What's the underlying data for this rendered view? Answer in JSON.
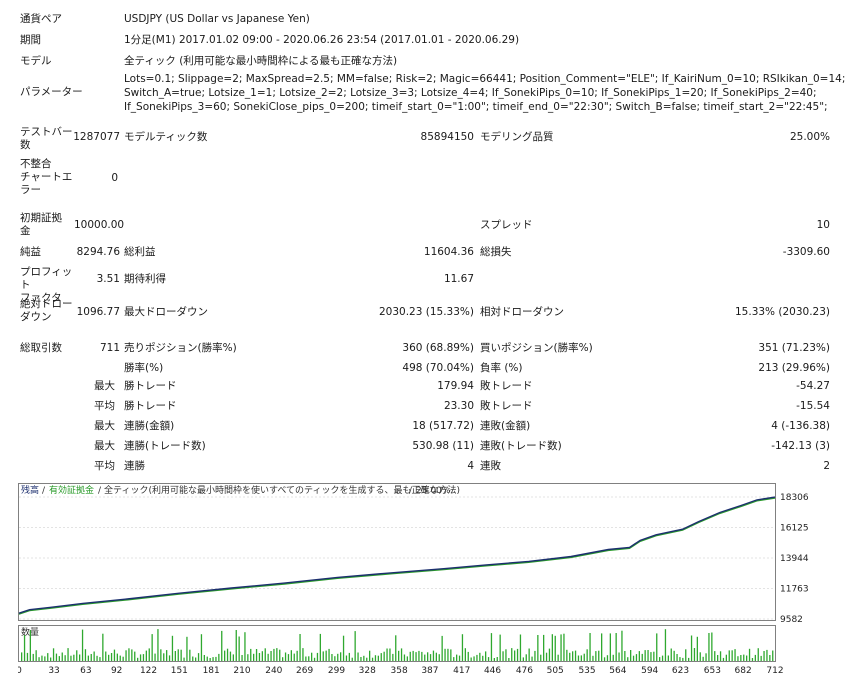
{
  "header": {
    "symbol_label": "通貨ペア",
    "symbol_value": "USDJPY (US Dollar vs Japanese Yen)",
    "period_label": "期間",
    "period_value": "1分足(M1) 2017.01.02 09:00 - 2020.06.26 23:54 (2017.01.01 - 2020.06.29)",
    "model_label": "モデル",
    "model_value": "全ティック (利用可能な最小時間枠による最も正確な方法)",
    "params_label": "パラメーター",
    "params_line1": "Lots=0.1; Slippage=2; MaxSpread=2.5; MM=false; Risk=2; Magic=66441; Position_Comment=\"ELE\"; If_KairiNum_0=10; RSIkikan_0=14;",
    "params_line2": "Switch_A=true; Lotsize_1=1; Lotsize_2=2; Lotsize_3=3; Lotsize_4=4; If_SonekiPips_0=10; If_SonekiPips_1=20; If_SonekiPips_2=40;",
    "params_line3": "If_SonekiPips_3=60; SonekiClose_pips_0=200; timeif_start_0=\"1:00\"; timeif_end_0=\"22:30\"; Switch_B=false; timeif_start_2=\"22:45\";"
  },
  "stats": {
    "bars_label_1": "テストバー",
    "bars_label_2": "数",
    "bars_value": "1287077",
    "ticks_label": "モデルティック数",
    "ticks_value": "85894150",
    "quality_label": "モデリング品質",
    "quality_value": "25.00%",
    "mismatch_label_1": "不整合",
    "mismatch_label_2": "チャートエ",
    "mismatch_label_3": "ラー",
    "mismatch_value": "0",
    "deposit_label_1": "初期証拠",
    "deposit_label_2": "金",
    "deposit_value": "10000.00",
    "spread_label": "スプレッド",
    "spread_value": "10",
    "net_label": "純益",
    "net_value": "8294.76",
    "gross_profit_label": "総利益",
    "gross_profit_value": "11604.36",
    "gross_loss_label": "総損失",
    "gross_loss_value": "-3309.60",
    "pf_label_1": "プロフィット",
    "pf_label_2": "ファクタ",
    "pf_value": "3.51",
    "expected_label": "期待利得",
    "expected_value": "11.67",
    "abs_dd_label_1": "絶対ドロー",
    "abs_dd_label_2": "ダウン",
    "abs_dd_value": "1096.77",
    "max_dd_label": "最大ドローダウン",
    "max_dd_value": "2030.23 (15.33%)",
    "rel_dd_label": "相対ドローダウン",
    "rel_dd_value": "15.33% (2030.23)",
    "total_label": "総取引数",
    "total_value": "711",
    "short_label": "売りポジション(勝率%)",
    "short_value": "360 (68.89%)",
    "long_label": "買いポジション(勝率%)",
    "long_value": "351 (71.23%)",
    "winrate_label": "勝率(%)",
    "winrate_value": "498 (70.04%)",
    "lossrate_label": "負率 (%)",
    "lossrate_value": "213 (29.96%)",
    "max_label": "最大",
    "avg_label": "平均",
    "max_win_label": "勝トレード",
    "max_win_value": "179.94",
    "max_loss_label": "敗トレード",
    "max_loss_value": "-54.27",
    "avg_win_label": "勝トレード",
    "avg_win_value": "23.30",
    "avg_loss_label": "敗トレード",
    "avg_loss_value": "-15.54",
    "consec_win_amt_label": "連勝(金額)",
    "consec_win_amt_value": "18 (517.72)",
    "consec_loss_amt_label": "連敗(金額)",
    "consec_loss_amt_value": "4 (-136.38)",
    "consec_win_profit_label": "連勝(トレード数)",
    "consec_win_profit_value": "530.98 (11)",
    "consec_loss_profit_label": "連敗(トレード数)",
    "consec_loss_profit_value": "-142.13 (3)",
    "avg_consec_win_label": "連勝",
    "avg_consec_win_value": "4",
    "avg_consec_loss_label": "連敗",
    "avg_consec_loss_value": "2"
  },
  "chart": {
    "legend_balance": "残高",
    "legend_sep1": "/",
    "legend_equity": "有効証拠金",
    "legend_sep2": "/",
    "legend_model": "全ティック(利用可能な最小時間枠を使いすべてのティックを生成する、最も正確な方法)",
    "legend_sep3": "/",
    "legend_quality": "25.00%",
    "volume_label": "数量",
    "colors": {
      "balance": "#1c2f6e",
      "equity": "#2a9b2a",
      "volume": "#2fa82f",
      "grid": "#c8c8c8"
    }
  },
  "chart_data": {
    "type": "line",
    "y_ticks": [
      "18306",
      "16125",
      "13944",
      "11763",
      "9582"
    ],
    "ylim": [
      9582,
      18306
    ],
    "x_ticks": [
      "0",
      "33",
      "63",
      "92",
      "122",
      "151",
      "181",
      "210",
      "240",
      "269",
      "299",
      "328",
      "358",
      "387",
      "417",
      "446",
      "476",
      "505",
      "535",
      "564",
      "594",
      "623",
      "653",
      "682",
      "712"
    ],
    "xlim": [
      0,
      712
    ],
    "series": [
      {
        "name": "残高",
        "x": [
          0,
          10,
          30,
          60,
          100,
          150,
          200,
          250,
          300,
          350,
          400,
          440,
          480,
          520,
          555,
          575,
          585,
          600,
          625,
          640,
          660,
          680,
          695,
          712
        ],
        "values": [
          10000,
          10250,
          10420,
          10700,
          11000,
          11420,
          11800,
          12150,
          12560,
          12880,
          13180,
          13450,
          13700,
          14050,
          14550,
          14700,
          15200,
          15600,
          16000,
          16550,
          17200,
          17700,
          18100,
          18300
        ]
      }
    ]
  }
}
